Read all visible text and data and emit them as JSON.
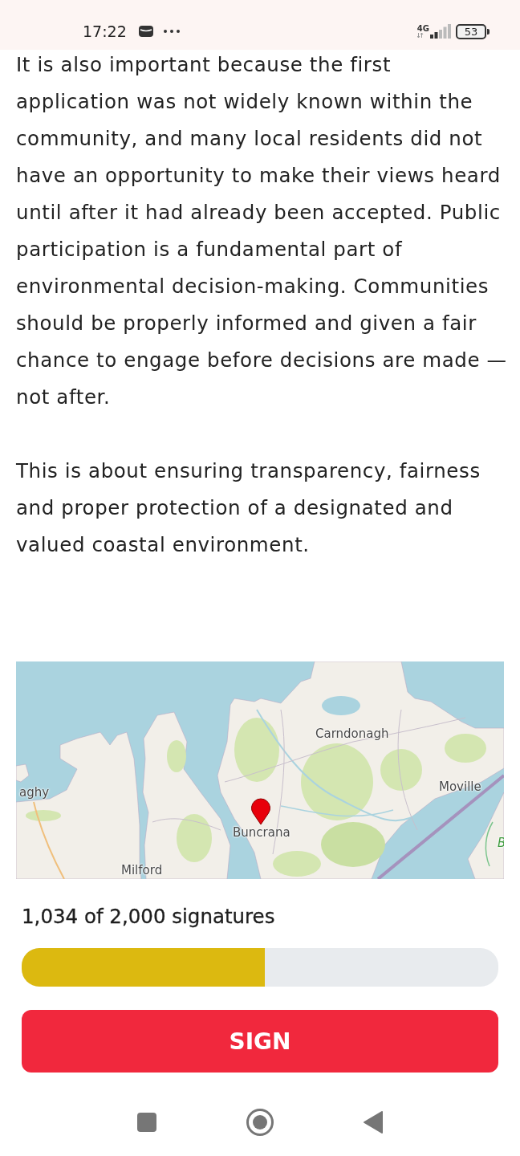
{
  "status_bar": {
    "time": "17:22",
    "network": "4G",
    "battery": "53"
  },
  "article": {
    "paragraphs": [
      "It is also important because the first application was not widely known within the community, and many local residents did not have an opportunity to make their views heard until after it had already been accepted. Public participation is a fundamental part of environmental decision-making. Communities should be properly informed and given a fair chance to engage before decisions are made — not after.",
      "This is about ensuring transparency, fairness and proper protection of a designated and valued coastal environment."
    ]
  },
  "map": {
    "labels": [
      {
        "text": "Carndonagh",
        "kind": "town"
      },
      {
        "text": "Moville",
        "kind": "town"
      },
      {
        "text": "aghy",
        "kind": "town"
      },
      {
        "text": "Buncrana",
        "kind": "town"
      },
      {
        "text": "B",
        "kind": "park"
      },
      {
        "text": "Milford",
        "kind": "town"
      }
    ]
  },
  "progress": {
    "label": "1,034 of 2,000 signatures",
    "level": 0.51
  },
  "sign_button": {
    "label": "SIGN"
  }
}
